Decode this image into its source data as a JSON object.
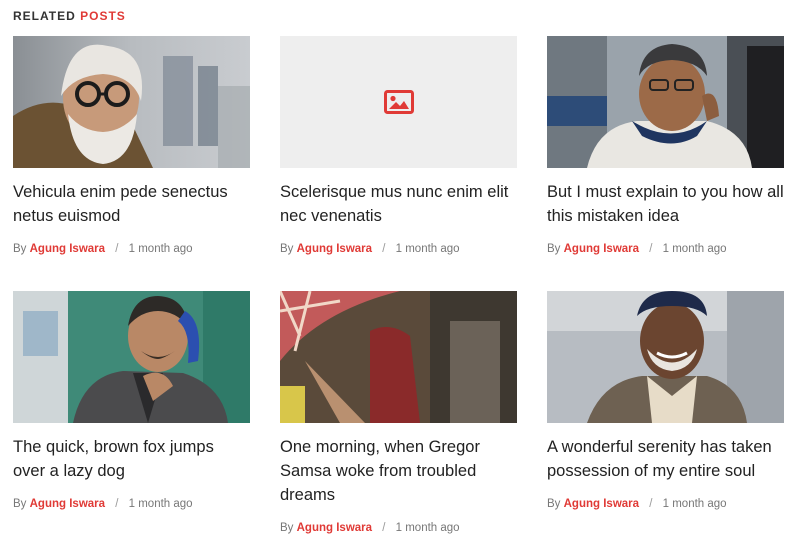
{
  "section": {
    "title_word1": "RELATED",
    "title_word2": "POSTS"
  },
  "meta_labels": {
    "by": "By",
    "separator": "/"
  },
  "colors": {
    "accent": "#e03a36",
    "text": "#222222",
    "muted": "#777777",
    "placeholder_bg": "#eeeeee"
  },
  "posts": [
    {
      "title": "Vehicula enim pede senectus netus euismod",
      "author": "Agung Iswara",
      "time": "1 month ago",
      "image": "photo-bearded-man-glasses"
    },
    {
      "title": "Scelerisque mus nunc enim elit nec venenatis",
      "author": "Agung Iswara",
      "time": "1 month ago",
      "image": "image-placeholder-icon"
    },
    {
      "title": "But I must explain to you how all this mistaken idea",
      "author": "Agung Iswara",
      "time": "1 month ago",
      "image": "photo-man-on-phone-scarf"
    },
    {
      "title": "The quick, brown fox jumps over a lazy dog",
      "author": "Agung Iswara",
      "time": "1 month ago",
      "image": "photo-man-blue-telephone"
    },
    {
      "title": "One morning, when Gregor Samsa woke from troubled dreams",
      "author": "Agung Iswara",
      "time": "1 month ago",
      "image": "photo-umbrella-street"
    },
    {
      "title": "A wonderful serenity has taken possession of my entire soul",
      "author": "Agung Iswara",
      "time": "1 month ago",
      "image": "photo-smiling-man-cap"
    }
  ]
}
